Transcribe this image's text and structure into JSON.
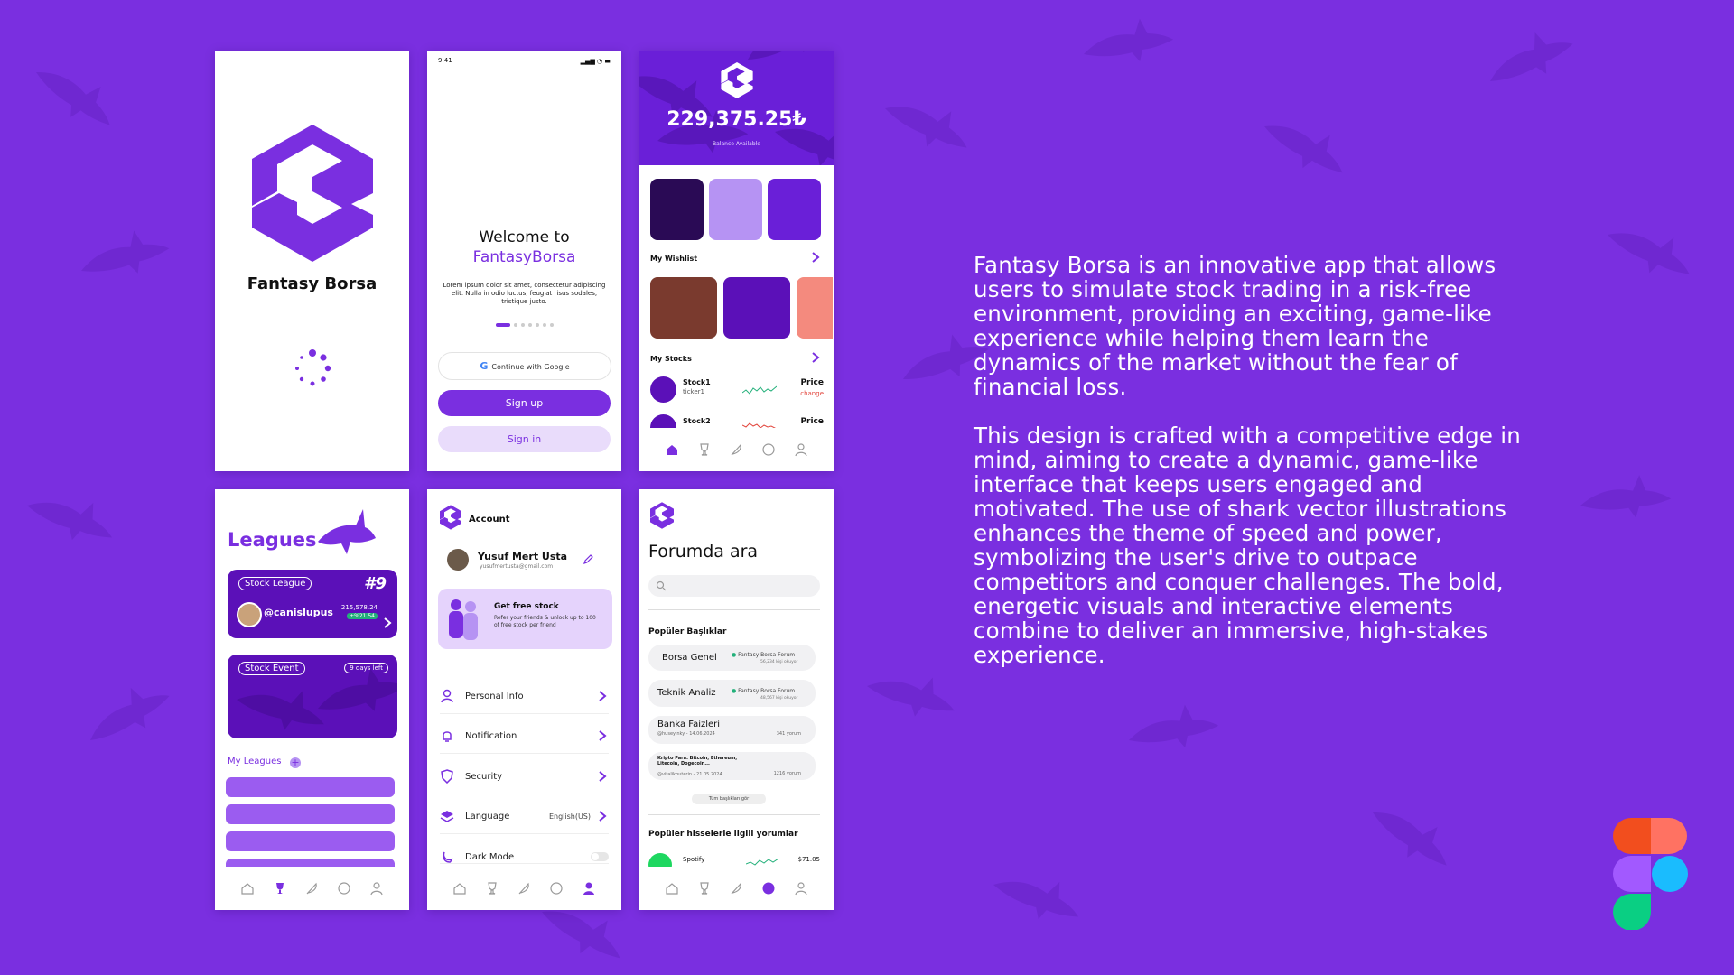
{
  "colors": {
    "brand": "#7a2fe0",
    "background": "#7a2fe0",
    "light_purple": "#e9dcfb"
  },
  "splash": {
    "app_name": "Fantasy Borsa"
  },
  "welcome": {
    "status_time": "9:41",
    "title": "Welcome to",
    "brand": "FantasyBorsa",
    "body": "Lorem ipsum dolor sit amet, consectetur adipiscing elit. Nulla in odio luctus, feugiat risus sodales, tristique justo.",
    "google_label": "Continue with Google",
    "signup_label": "Sign up",
    "signin_label": "Sign in"
  },
  "home": {
    "balance": "229,375.25₺",
    "balance_caption": "Balance Available",
    "wishlist_title": "My Wishlist",
    "stocks_title": "My Stocks",
    "stocks": [
      {
        "name": "Stock1",
        "ticker": "ticker1",
        "price": "Price",
        "change": "change"
      },
      {
        "name": "Stock2",
        "ticker": "",
        "price": "Price",
        "change": ""
      }
    ]
  },
  "leagues": {
    "title": "Leagues",
    "card1": {
      "tag": "Stock League",
      "rank": "#9",
      "user": "@canislupus",
      "value": "215,578.24",
      "delta": "+%21.54"
    },
    "card2": {
      "tag": "Stock Event",
      "badge": "9 days left"
    },
    "my_leagues": "My Leagues"
  },
  "account": {
    "title": "Account",
    "user_name": "Yusuf Mert Usta",
    "user_email": "yusufmertusta@gmail.com",
    "promo_title": "Get free stock",
    "promo_body": "Refer your friends & unlock up to 100 of free stock per friend",
    "items": [
      {
        "label": "Personal Info",
        "value": ""
      },
      {
        "label": "Notification",
        "value": ""
      },
      {
        "label": "Security",
        "value": ""
      },
      {
        "label": "Language",
        "value": "English(US)"
      },
      {
        "label": "Dark Mode",
        "value": ""
      }
    ]
  },
  "forum": {
    "title": "Forumda ara",
    "popular_title": "Popüler Başlıklar",
    "topics": [
      {
        "name": "Borsa Genel",
        "forum": "Fantasy Borsa Forum",
        "meta": "56,234 kişi okuyor"
      },
      {
        "name": "Teknik Analiz",
        "forum": "Fantasy Borsa Forum",
        "meta": "48,567 kişi okuyor"
      }
    ],
    "posts": [
      {
        "title": "Banka Faizleri",
        "author": "@huseyinky - 14.06.2024",
        "comments": "341 yorum"
      },
      {
        "title": "Kripto Para: Bitcoin, Ethereum, Litecoin, Dogecoin...",
        "author": "@vitalikbuterin - 21.05.2024",
        "comments": "1216 yorum"
      }
    ],
    "see_all": "Tüm başlıkları gör",
    "comments_title": "Popüler hisselerle ilgili yorumlar",
    "stock_name": "Spotify",
    "stock_price": "$71.05"
  },
  "description": {
    "p1": "Fantasy Borsa is an innovative app that allows users to simulate stock trading in a risk-free environment, providing an exciting, game-like experience while helping them learn the dynamics of the market without the fear of financial loss.",
    "p2": "This design is crafted with a competitive edge in mind, aiming to create a dynamic, game-like interface that keeps users engaged and motivated. The use of shark vector illustrations enhances the theme of speed and power, symbolizing the user's drive to outpace competitors and conquer challenges. The bold, energetic visuals and interactive elements combine to deliver an immersive, high-stakes experience."
  }
}
